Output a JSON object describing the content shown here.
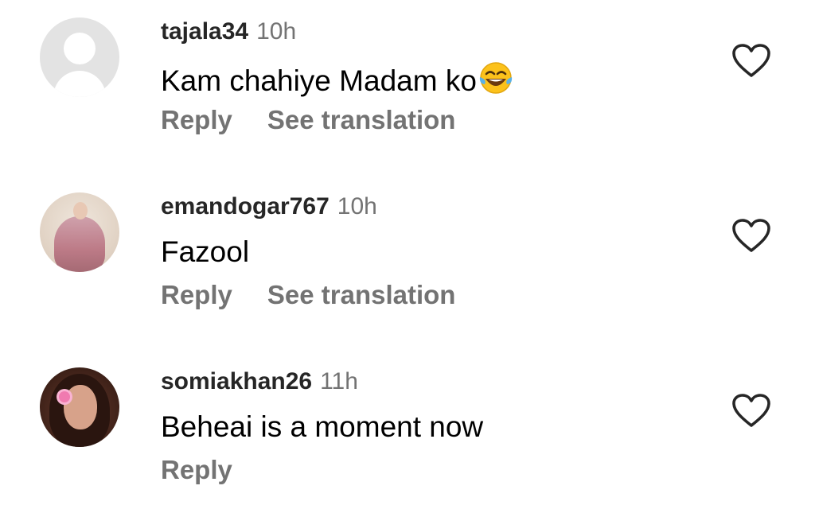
{
  "comments": [
    {
      "username": "tajala34",
      "time": "10h",
      "text": "Kam chahiye Madam ko",
      "emoji": "face-with-tears-of-joy",
      "reply_label": "Reply",
      "translate_label": "See translation",
      "avatar": "default-avatar"
    },
    {
      "username": "emandogar767",
      "time": "10h",
      "text": "Fazool",
      "reply_label": "Reply",
      "translate_label": "See translation",
      "avatar": "profile-photo"
    },
    {
      "username": "somiakhan26",
      "time": "11h",
      "text": "Beheai is a moment now",
      "reply_label": "Reply",
      "avatar": "profile-photo"
    }
  ],
  "icons": {
    "like": "heart-outline-icon"
  },
  "colors": {
    "username": "#262626",
    "secondary_text": "#737373",
    "comment_text": "#000000",
    "background": "#ffffff"
  }
}
